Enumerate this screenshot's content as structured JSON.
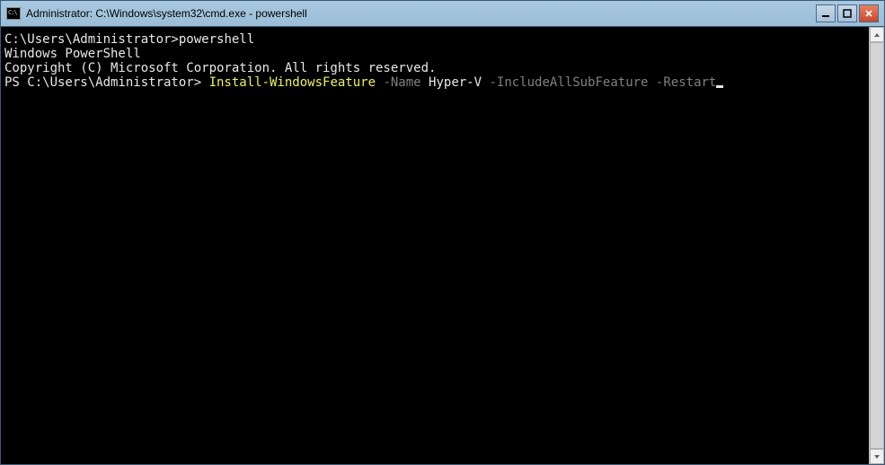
{
  "window": {
    "title": "Administrator: C:\\Windows\\system32\\cmd.exe - powershell"
  },
  "terminal": {
    "line1_prompt": "C:\\Users\\Administrator>",
    "line1_cmd": "powershell",
    "line2": "Windows PowerShell",
    "line3": "Copyright (C) Microsoft Corporation. All rights reserved.",
    "line4": "",
    "ps_prompt": "PS C:\\Users\\Administrator> ",
    "tok_cmd": "Install-WindowsFeature",
    "tok_p1": " -Name ",
    "tok_v1": "Hyper-V",
    "tok_p2": " -IncludeAllSubFeature ",
    "tok_p3": "-Restart"
  }
}
